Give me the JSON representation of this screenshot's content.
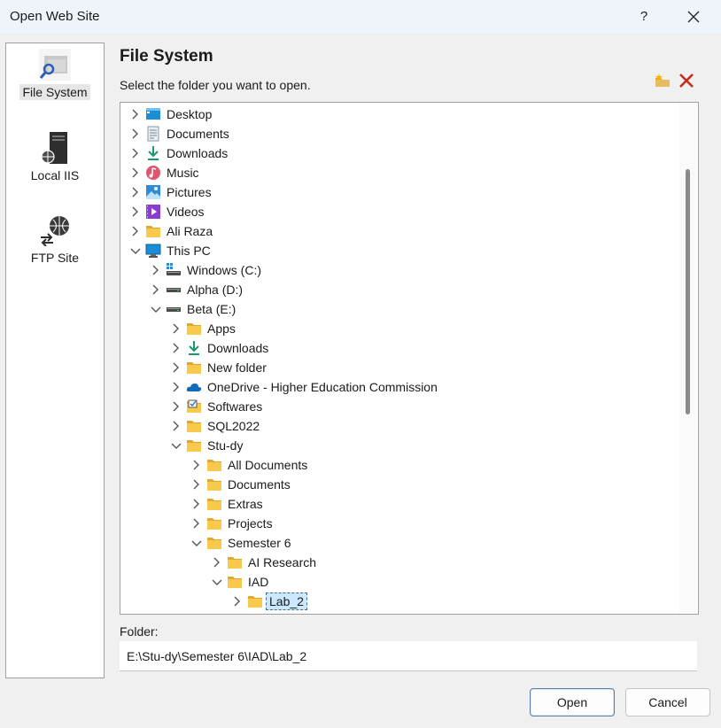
{
  "window": {
    "title": "Open Web Site",
    "help_label": "?",
    "close_label": "✕"
  },
  "sidebar": {
    "items": [
      {
        "label": "File System",
        "icon": "file-system-icon",
        "selected": true
      },
      {
        "label": "Local IIS",
        "icon": "server-icon",
        "selected": false
      },
      {
        "label": "FTP Site",
        "icon": "ftp-globe-icon",
        "selected": false
      }
    ]
  },
  "main": {
    "heading": "File System",
    "instruction": "Select the folder you want to open."
  },
  "toolbar": {
    "new_folder_icon": "new-folder-icon",
    "delete_icon": "delete-icon"
  },
  "tree": {
    "items": [
      {
        "label": "Desktop",
        "depth": 0,
        "expanded": false,
        "icon": "desktop-icon"
      },
      {
        "label": "Documents",
        "depth": 0,
        "expanded": false,
        "icon": "documents-icon"
      },
      {
        "label": "Downloads",
        "depth": 0,
        "expanded": false,
        "icon": "downloads-icon"
      },
      {
        "label": "Music",
        "depth": 0,
        "expanded": false,
        "icon": "music-icon"
      },
      {
        "label": "Pictures",
        "depth": 0,
        "expanded": false,
        "icon": "pictures-icon"
      },
      {
        "label": "Videos",
        "depth": 0,
        "expanded": false,
        "icon": "videos-icon"
      },
      {
        "label": "Ali Raza",
        "depth": 0,
        "expanded": false,
        "icon": "folder-icon"
      },
      {
        "label": "This PC",
        "depth": 0,
        "expanded": true,
        "icon": "this-pc-icon"
      },
      {
        "label": "Windows (C:)",
        "depth": 1,
        "expanded": false,
        "icon": "windows-drive-icon"
      },
      {
        "label": "Alpha (D:)",
        "depth": 1,
        "expanded": false,
        "icon": "drive-icon"
      },
      {
        "label": "Beta (E:)",
        "depth": 1,
        "expanded": true,
        "icon": "drive-icon"
      },
      {
        "label": "Apps",
        "depth": 2,
        "expanded": false,
        "icon": "folder-icon"
      },
      {
        "label": "Downloads",
        "depth": 2,
        "expanded": false,
        "icon": "downloads-icon"
      },
      {
        "label": "New folder",
        "depth": 2,
        "expanded": false,
        "icon": "folder-icon"
      },
      {
        "label": "OneDrive - Higher Education Commission",
        "depth": 2,
        "expanded": false,
        "icon": "onedrive-icon"
      },
      {
        "label": "Softwares",
        "depth": 2,
        "expanded": false,
        "icon": "softwares-folder-icon"
      },
      {
        "label": "SQL2022",
        "depth": 2,
        "expanded": false,
        "icon": "folder-icon"
      },
      {
        "label": "Stu-dy",
        "depth": 2,
        "expanded": true,
        "icon": "folder-icon"
      },
      {
        "label": "All Documents",
        "depth": 3,
        "expanded": false,
        "icon": "folder-icon"
      },
      {
        "label": "Documents",
        "depth": 3,
        "expanded": false,
        "icon": "folder-icon"
      },
      {
        "label": "Extras",
        "depth": 3,
        "expanded": false,
        "icon": "folder-icon"
      },
      {
        "label": "Projects",
        "depth": 3,
        "expanded": false,
        "icon": "folder-icon"
      },
      {
        "label": "Semester 6",
        "depth": 3,
        "expanded": true,
        "icon": "folder-icon"
      },
      {
        "label": "AI Research",
        "depth": 4,
        "expanded": false,
        "icon": "folder-icon"
      },
      {
        "label": "IAD",
        "depth": 4,
        "expanded": true,
        "icon": "folder-icon"
      },
      {
        "label": "Lab_2",
        "depth": 5,
        "expanded": false,
        "icon": "folder-icon",
        "selected": true
      }
    ]
  },
  "folder": {
    "label": "Folder:",
    "value": "E:\\Stu-dy\\Semester 6\\IAD\\Lab_2"
  },
  "buttons": {
    "open": "Open",
    "cancel": "Cancel"
  },
  "colors": {
    "title_bar": "#eef4f9",
    "selection": "#cce8ff",
    "folder": "#f8c94a",
    "delete": "#c42b1c"
  }
}
